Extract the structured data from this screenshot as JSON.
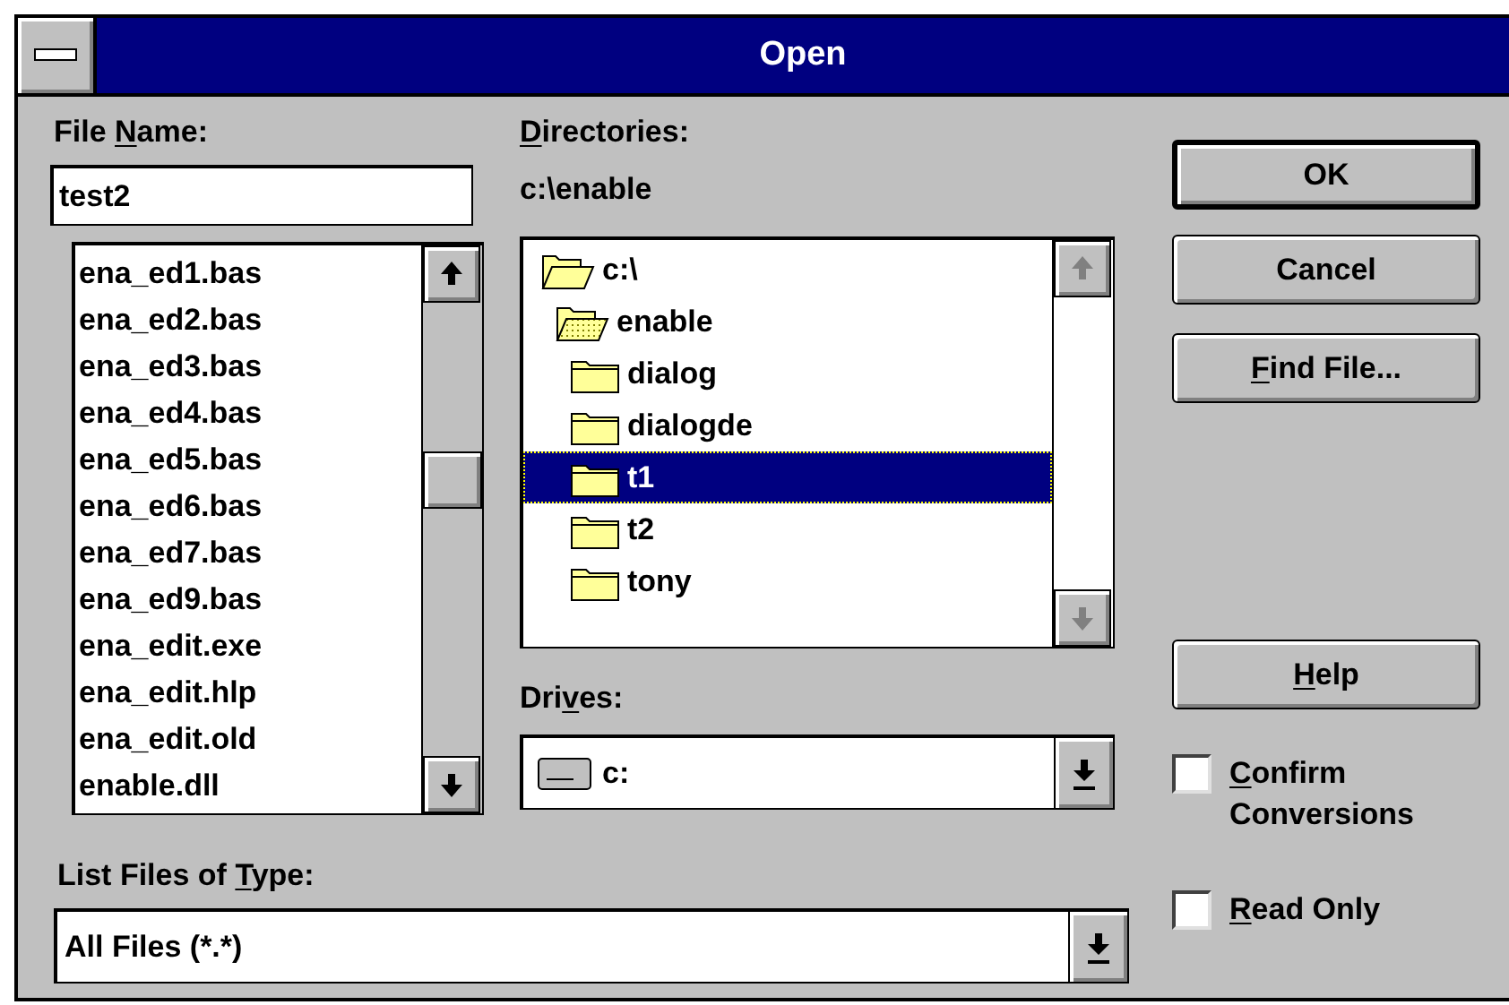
{
  "window": {
    "title": "Open"
  },
  "file_name": {
    "label": [
      {
        "text": "File ",
        "underlined": false
      },
      {
        "text": "N",
        "underlined": true
      },
      {
        "text": "ame:",
        "underlined": false
      }
    ],
    "value": "test2"
  },
  "files": [
    "ena_ed1.bas",
    "ena_ed2.bas",
    "ena_ed3.bas",
    "ena_ed4.bas",
    "ena_ed5.bas",
    "ena_ed6.bas",
    "ena_ed7.bas",
    "ena_ed9.bas",
    "ena_edit.exe",
    "ena_edit.hlp",
    "ena_edit.old",
    "enable.dll"
  ],
  "directories": {
    "label": [
      {
        "text": "D",
        "underlined": true
      },
      {
        "text": "irectories:",
        "underlined": false
      }
    ],
    "path": "c:\\enable",
    "tree": [
      {
        "name": "c:\\",
        "kind": "open_root",
        "selected": false,
        "children": [
          {
            "name": "enable",
            "kind": "open",
            "selected": false,
            "children": [
              {
                "name": "dialog",
                "kind": "closed",
                "selected": false
              },
              {
                "name": "dialogde",
                "kind": "closed",
                "selected": false
              },
              {
                "name": "t1",
                "kind": "closed",
                "selected": true
              },
              {
                "name": "t2",
                "kind": "closed",
                "selected": false
              },
              {
                "name": "tony",
                "kind": "closed",
                "selected": false
              }
            ]
          }
        ]
      }
    ]
  },
  "drives": {
    "label": [
      {
        "text": "Dri",
        "underlined": false
      },
      {
        "text": "v",
        "underlined": true
      },
      {
        "text": "es:",
        "underlined": false
      }
    ],
    "value": "c:"
  },
  "file_type": {
    "label": [
      {
        "text": "List Files of ",
        "underlined": false
      },
      {
        "text": "T",
        "underlined": true
      },
      {
        "text": "ype:",
        "underlined": false
      }
    ],
    "value": "All Files (*.*)"
  },
  "buttons": [
    {
      "label": [
        {
          "text": "OK",
          "underlined": false
        }
      ],
      "default": true
    },
    {
      "label": [
        {
          "text": "Cancel",
          "underlined": false
        }
      ],
      "default": false
    },
    {
      "label": [
        {
          "text": "F",
          "underlined": true
        },
        {
          "text": "ind File...",
          "underlined": false
        }
      ],
      "default": false
    },
    {
      "label": [
        {
          "text": "H",
          "underlined": true
        },
        {
          "text": "elp",
          "underlined": false
        }
      ],
      "default": false
    }
  ],
  "checkboxes": [
    {
      "label": [
        {
          "text": "C",
          "underlined": true
        },
        {
          "text": "onfirm Conversions",
          "underlined": false
        }
      ],
      "checked": false
    },
    {
      "label": [
        {
          "text": "R",
          "underlined": true
        },
        {
          "text": "ead Only",
          "underlined": false
        }
      ],
      "checked": false
    }
  ]
}
